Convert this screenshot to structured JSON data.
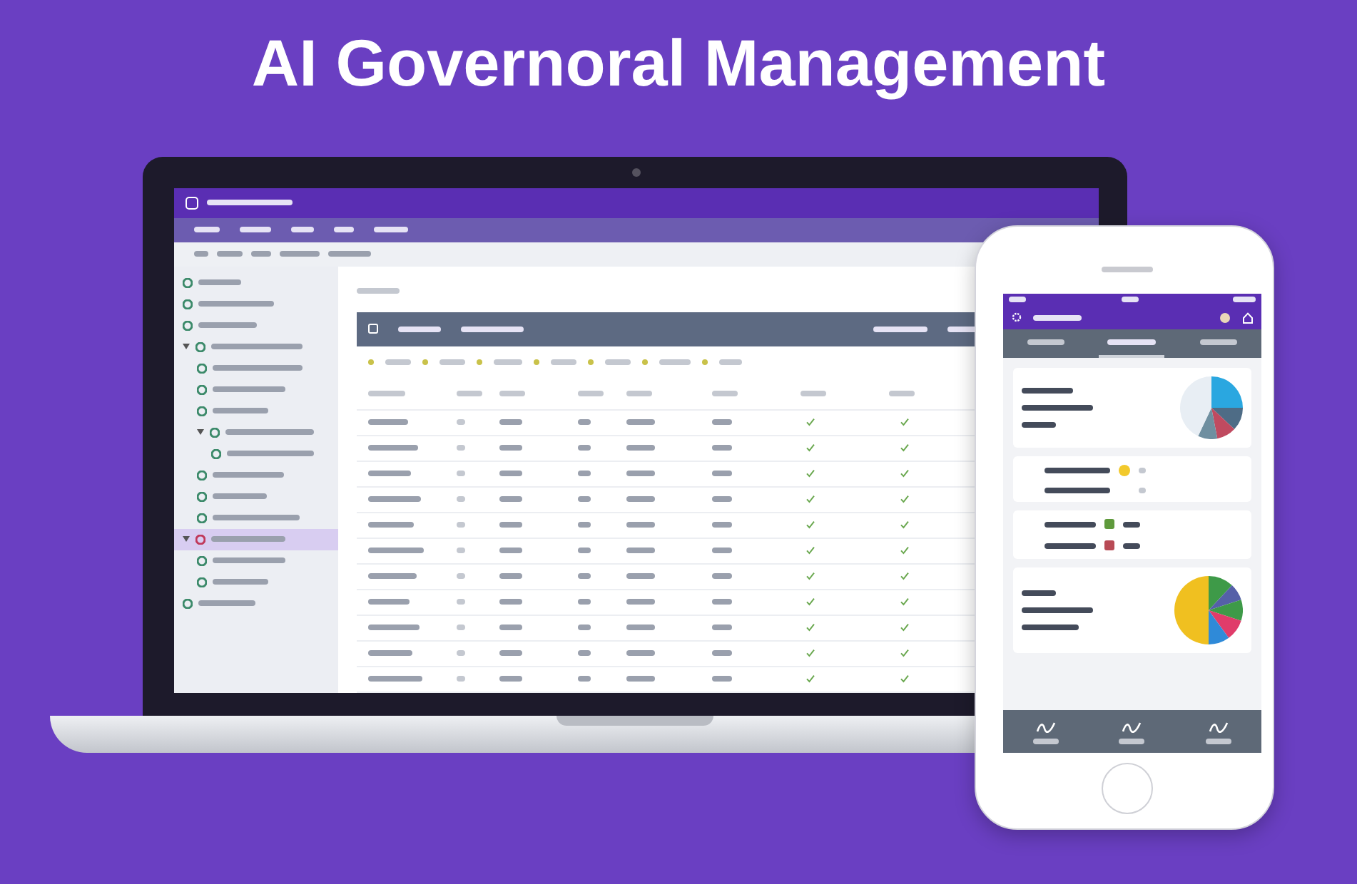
{
  "title": "AI Governoral Management",
  "laptop": {
    "sidebar": {
      "items": [
        {
          "selected": false
        },
        {
          "selected": false
        },
        {
          "selected": false
        },
        {
          "selected": false,
          "children": [
            {
              "selected": false
            },
            {
              "selected": false
            },
            {
              "selected": false
            },
            {
              "selected": false,
              "children": [
                {
                  "selected": false
                }
              ]
            },
            {
              "selected": false
            },
            {
              "selected": false
            },
            {
              "selected": false
            }
          ]
        },
        {
          "selected": true,
          "children": [
            {
              "selected": false
            },
            {
              "selected": false
            }
          ]
        },
        {
          "selected": false
        }
      ]
    },
    "table": {
      "rows": [
        {
          "column_7_checked": true,
          "column_8_checked": true
        },
        {
          "column_7_checked": true,
          "column_8_checked": true
        },
        {
          "column_7_checked": true,
          "column_8_checked": true
        },
        {
          "column_7_checked": true,
          "column_8_checked": true
        },
        {
          "column_7_checked": true,
          "column_8_checked": true
        },
        {
          "column_7_checked": true,
          "column_8_checked": true
        },
        {
          "column_7_checked": true,
          "column_8_checked": true
        },
        {
          "column_7_checked": true,
          "column_8_checked": true
        },
        {
          "column_7_checked": true,
          "column_8_checked": true
        },
        {
          "column_7_checked": true,
          "column_8_checked": true
        },
        {
          "column_7_checked": true,
          "column_8_checked": true
        }
      ]
    }
  },
  "phone": {
    "tabs": [
      {
        "selected": false
      },
      {
        "selected": true
      },
      {
        "selected": false
      }
    ]
  }
}
